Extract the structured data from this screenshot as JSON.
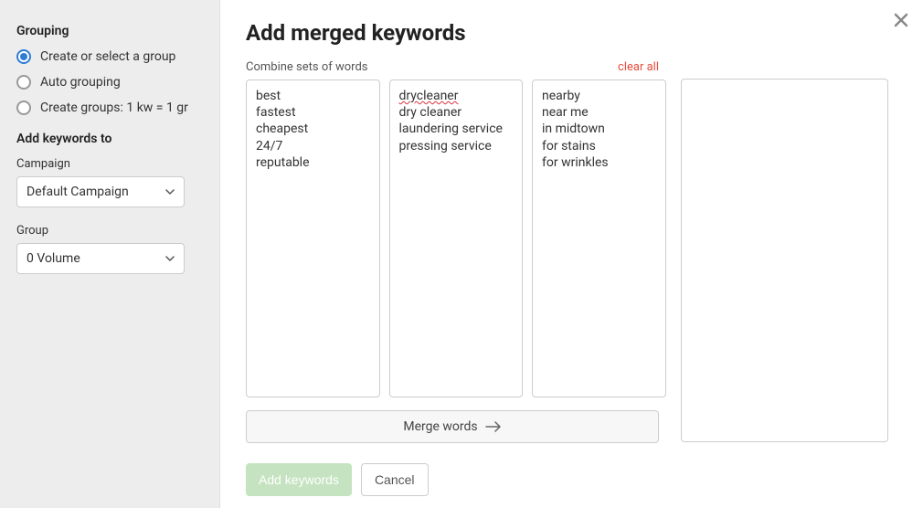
{
  "sidebar": {
    "grouping_title": "Grouping",
    "radios": [
      {
        "label": "Create or select a group",
        "checked": true
      },
      {
        "label": "Auto grouping",
        "checked": false
      },
      {
        "label": "Create groups: 1 kw = 1 gr",
        "checked": false
      }
    ],
    "add_keywords_title": "Add keywords to",
    "campaign_label": "Campaign",
    "campaign_value": "Default Campaign",
    "group_label": "Group",
    "group_value": "0 Volume"
  },
  "main": {
    "title": "Add merged keywords",
    "subtitle": "Combine sets of words",
    "clear_all": "clear all",
    "columns": [
      "best\nfastest\ncheapest\n24/7\nreputable",
      "drycleaner\ndry cleaner\nlaundering service\npressing service",
      "nearby\nnear me\nin midtown\nfor stains\nfor wrinkles"
    ],
    "column2_spellcheck_word": "drycleaner",
    "merge_label": "Merge words",
    "add_keywords_btn": "Add keywords",
    "cancel_btn": "Cancel"
  }
}
